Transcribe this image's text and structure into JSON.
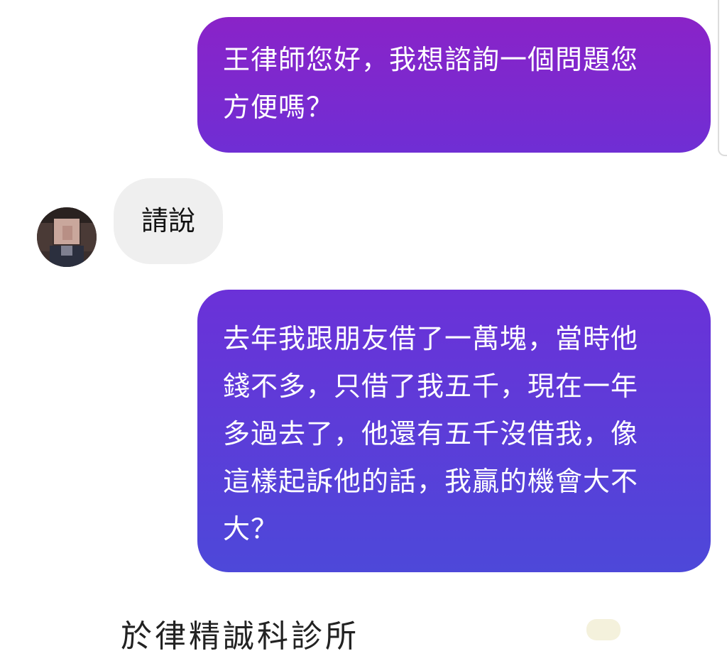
{
  "chat": {
    "messages": [
      {
        "sender": "user",
        "text": "王律師您好，我想諮詢一個問題您\n方便嗎？"
      },
      {
        "sender": "lawyer",
        "text": "請說"
      },
      {
        "sender": "user",
        "text": "去年我跟朋友借了一萬塊，當時他\n錢不多，只借了我五千，現在一年\n多過去了，他還有五千沒借我，像\n這樣起訴他的話，我贏的機會大不\n大？"
      }
    ]
  },
  "footer": {
    "partial_label": "於律精誠科診所"
  },
  "colors": {
    "bubble_top": "#8a23c8",
    "bubble_bottom": "#4d48d9",
    "incoming_bubble": "#efefef"
  }
}
